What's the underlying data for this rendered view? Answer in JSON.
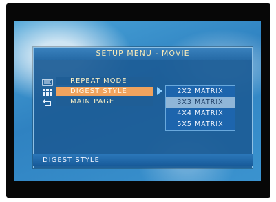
{
  "menu": {
    "title": "SETUP MENU - MOVIE",
    "items": [
      {
        "label": "REPEAT MODE",
        "icon": "repeat-icon"
      },
      {
        "label": "DIGEST STYLE",
        "icon": "grid-icon"
      },
      {
        "label": "MAIN PAGE",
        "icon": "return-icon"
      }
    ],
    "selected_item": "DIGEST STYLE"
  },
  "submenu": {
    "options": [
      "2X2 MATRIX",
      "3X3 MATRIX",
      "4X4 MATRIX",
      "5X5 MATRIX"
    ],
    "selected": "3X3 MATRIX"
  },
  "status": {
    "text": "DIGEST STYLE"
  },
  "colors": {
    "panel": "#1f5e96",
    "selected_item": "#f0a35e",
    "submenu": "#1d65ad",
    "submenu_selected": "#8fb6d8"
  }
}
